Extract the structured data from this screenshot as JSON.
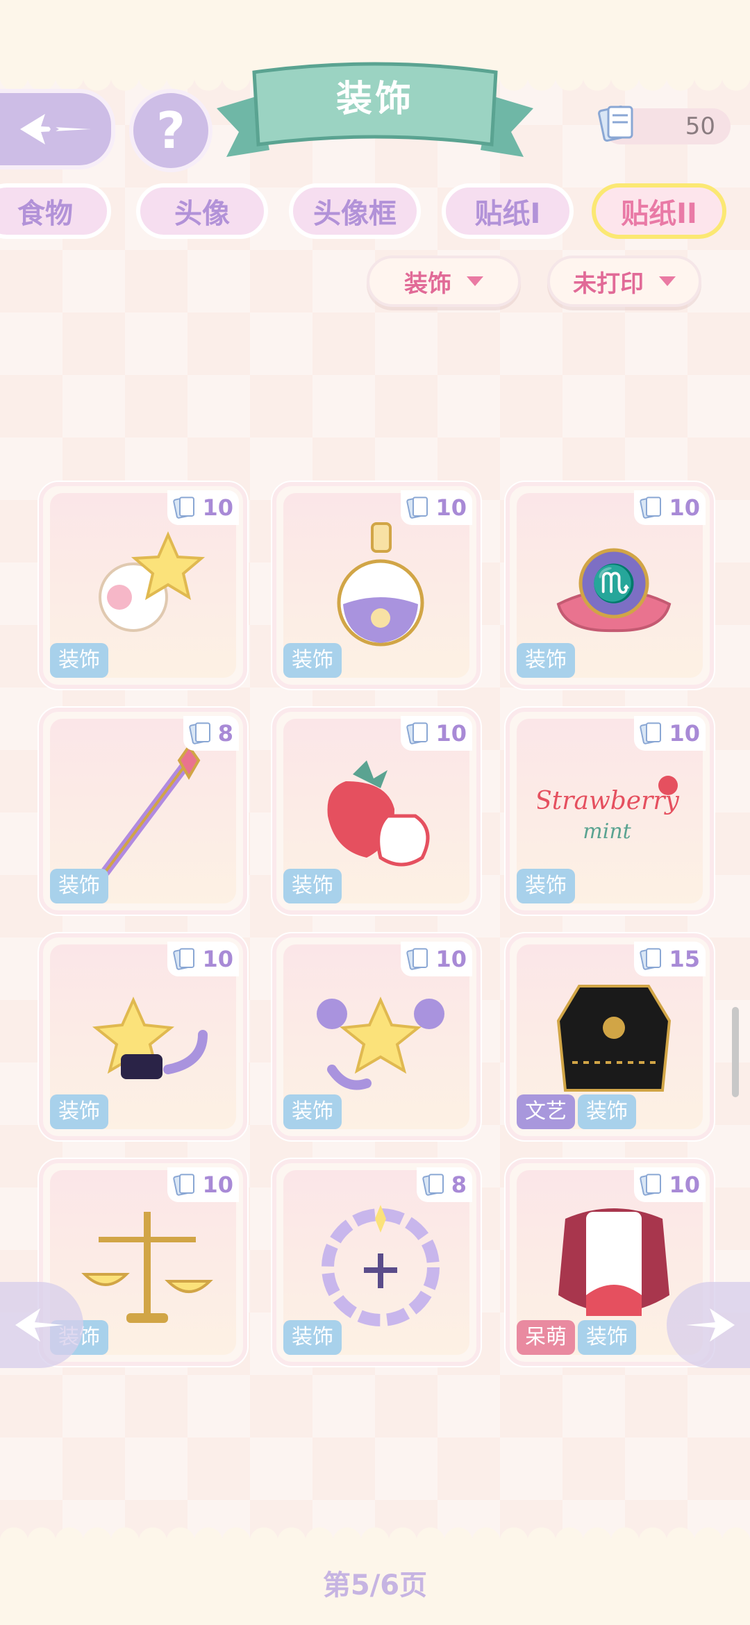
{
  "header": {
    "title": "装饰",
    "currency_value": "50",
    "help_label": "?"
  },
  "tabs": [
    {
      "label": "食物",
      "active": false
    },
    {
      "label": "头像",
      "active": false
    },
    {
      "label": "头像框",
      "active": false
    },
    {
      "label": "贴纸I",
      "active": false
    },
    {
      "label": "贴纸II",
      "active": true
    }
  ],
  "filters": {
    "category": "装饰",
    "status": "未打印"
  },
  "items": [
    {
      "cost": "10",
      "tags": [
        "装饰"
      ],
      "art": "star-sheep-icon"
    },
    {
      "cost": "10",
      "tags": [
        "装饰"
      ],
      "art": "potion-bottle-icon"
    },
    {
      "cost": "10",
      "tags": [
        "装饰"
      ],
      "art": "scorpio-cushion-icon"
    },
    {
      "cost": "8",
      "tags": [
        "装饰"
      ],
      "art": "magic-wand-icon"
    },
    {
      "cost": "10",
      "tags": [
        "装饰"
      ],
      "art": "strawberry-icon"
    },
    {
      "cost": "10",
      "tags": [
        "装饰"
      ],
      "art": "strawberry-mint-text-icon"
    },
    {
      "cost": "10",
      "tags": [
        "装饰"
      ],
      "art": "star-scorpion-icon"
    },
    {
      "cost": "10",
      "tags": [
        "装饰"
      ],
      "art": "star-crab-icon"
    },
    {
      "cost": "15",
      "tags": [
        "文艺",
        "装饰"
      ],
      "art": "black-outfit-icon"
    },
    {
      "cost": "10",
      "tags": [
        "装饰"
      ],
      "art": "libra-scale-icon"
    },
    {
      "cost": "8",
      "tags": [
        "装饰"
      ],
      "art": "zodiac-wreath-icon"
    },
    {
      "cost": "10",
      "tags": [
        "呆萌",
        "装饰"
      ],
      "art": "lolita-dress-icon"
    }
  ],
  "art_text": {
    "strawberry": "Strawberry",
    "mint": "mint"
  },
  "pagination": {
    "label": "第5/6页"
  },
  "colors": {
    "accent": "#b292d8",
    "active_tab": "#e97aa6",
    "tag_blue": "#a8d1eb",
    "tag_purple": "#a897dc",
    "tag_pink": "#e98aa0"
  }
}
